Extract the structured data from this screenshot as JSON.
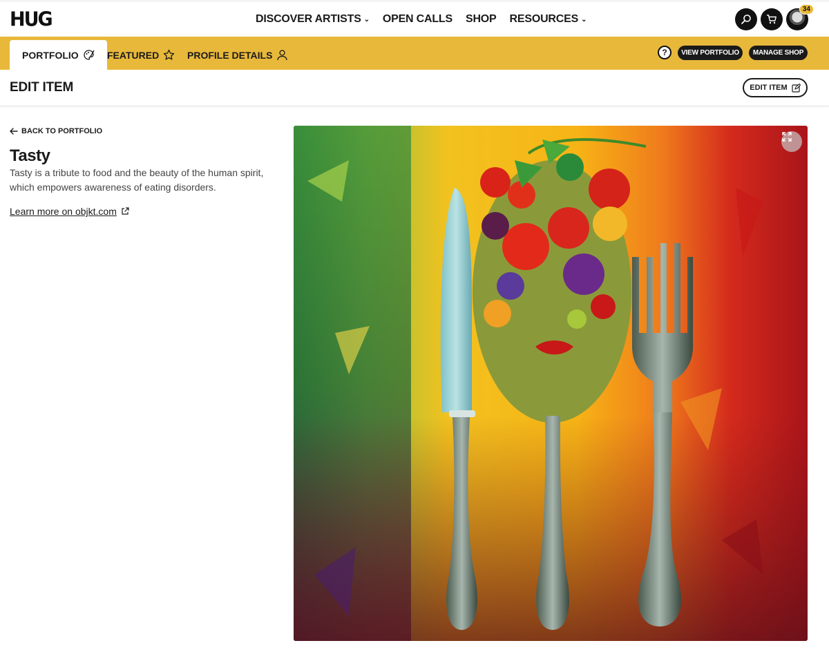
{
  "brand": {
    "logo_text": "HUG"
  },
  "nav": {
    "links": [
      {
        "label": "DISCOVER ARTISTS",
        "has_dropdown": true
      },
      {
        "label": "OPEN CALLS",
        "has_dropdown": false
      },
      {
        "label": "SHOP",
        "has_dropdown": false
      },
      {
        "label": "RESOURCES",
        "has_dropdown": true
      }
    ],
    "icons": [
      "search-icon",
      "cart-icon"
    ],
    "notification_count": "34"
  },
  "tabs": {
    "items": [
      {
        "label": "PORTFOLIO",
        "icon": "palette-icon",
        "active": true
      },
      {
        "label": "FEATURED",
        "icon": "star-icon",
        "active": false
      },
      {
        "label": "PROFILE DETAILS",
        "icon": "user-icon",
        "active": false
      }
    ],
    "help_label": "?",
    "view_portfolio_label": "VIEW PORTFOLIO",
    "manage_shop_label": "MANAGE SHOP",
    "bar_color": "#e8b83a"
  },
  "page": {
    "title": "EDIT ITEM",
    "edit_button_label": "EDIT ITEM"
  },
  "item": {
    "back_label": "BACK TO PORTFOLIO",
    "title": "Tasty",
    "description": "Tasty is a tribute to food and the beauty of the human spirit, which empowers awareness of eating disorders.",
    "learn_more_label": "Learn more on objkt.com"
  },
  "artwork": {
    "subject": "painting of a face made of vegetables between a knife, spoon and fork",
    "expand_icon": "expand-icon"
  }
}
